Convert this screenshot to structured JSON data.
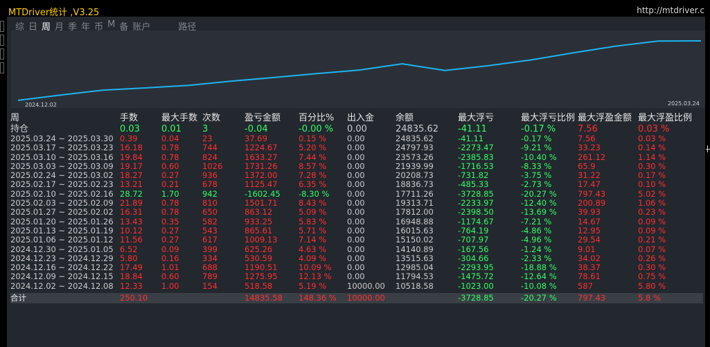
{
  "app": {
    "title": "MTDriver统计 ,V3.25",
    "url": "http://mtdriver.c"
  },
  "tabs": [
    {
      "label": "综"
    },
    {
      "label": "日"
    },
    {
      "label": "周"
    },
    {
      "label": "月"
    },
    {
      "label": "季"
    },
    {
      "label": "年"
    },
    {
      "label": "币"
    },
    {
      "label": "M"
    },
    {
      "label": "备"
    },
    {
      "label": "账户"
    },
    {
      "label": "路径"
    }
  ],
  "active_tab": "周",
  "colors": {
    "positive": "#ff3030",
    "negative": "#33ff66",
    "line": "#1eb4f0",
    "title": "#ffd200"
  },
  "chart_data": {
    "type": "line",
    "x": [
      "2024.12.02",
      "2024.12.09",
      "2024.12.16",
      "2024.12.23",
      "2024.12.30",
      "2025.01.06",
      "2025.01.13",
      "2025.01.20",
      "2025.01.27",
      "2025.02.03",
      "2025.02.10",
      "2025.02.17",
      "2025.02.24",
      "2025.03.03",
      "2025.03.10",
      "2025.03.17",
      "2025.03.24"
    ],
    "series": [
      {
        "values": [
          10518.58,
          11794.53,
          12985.04,
          13515.63,
          14140.89,
          15150.02,
          16015.63,
          16948.88,
          17812.0,
          19313.71,
          17711.26,
          18836.73,
          20208.73,
          21939.99,
          23573.26,
          24797.93,
          24835.62
        ]
      }
    ],
    "x_start_label": "2024.12.02",
    "x_end_label": "2025.03.24",
    "ylim": [
      10000,
      26000
    ],
    "grid": false
  },
  "table": {
    "headers": [
      "周",
      "手数",
      "最大手数",
      "次数",
      "盈亏金额",
      "百分比%",
      "出入金",
      "余额",
      "最大浮亏",
      "最大浮亏比例",
      "最大浮盈金额",
      "最大浮盈比例"
    ],
    "holding": {
      "label": "持仓",
      "cells": [
        "0.03",
        "0.01",
        "3",
        "-0.04",
        "-0.00 %",
        "0.00",
        "24835.62",
        "-41.11",
        "-0.17 %",
        "7.56",
        "0.03 %"
      ],
      "tone": "neg"
    },
    "rows": [
      {
        "cells": [
          "2025.03.24 ~ 2025.03.30",
          "0.39",
          "0.04",
          "23",
          "37.69",
          "0.15 %",
          "0.00",
          "24835.62",
          "-41.11",
          "-0.17 %",
          "7.56",
          "0.03 %"
        ],
        "tone": "pos"
      },
      {
        "cells": [
          "2025.03.17 ~ 2025.03.23",
          "16.18",
          "0.78",
          "744",
          "1224.67",
          "5.20 %",
          "0.00",
          "24797.93",
          "-2273.47",
          "-9.21 %",
          "33.23",
          "0.14 %"
        ],
        "tone": "pos"
      },
      {
        "cells": [
          "2025.03.10 ~ 2025.03.16",
          "19.84",
          "0.78",
          "824",
          "1633.27",
          "7.44 %",
          "0.00",
          "23573.26",
          "-2385.83",
          "-10.40 %",
          "261.12",
          "1.14 %"
        ],
        "tone": "pos"
      },
      {
        "cells": [
          "2025.03.03 ~ 2025.03.09",
          "19.17",
          "0.60",
          "1026",
          "1731.26",
          "8.57 %",
          "0.00",
          "21939.99",
          "-1716.53",
          "-8.33 %",
          "65.9",
          "0.30 %"
        ],
        "tone": "pos"
      },
      {
        "cells": [
          "2025.02.24 ~ 2025.03.02",
          "18.27",
          "0.27",
          "936",
          "1372.00",
          "7.28 %",
          "0.00",
          "20208.73",
          "-731.82",
          "-3.75 %",
          "31.22",
          "0.17 %"
        ],
        "tone": "pos"
      },
      {
        "cells": [
          "2025.02.17 ~ 2025.02.23",
          "13.21",
          "0.21",
          "678",
          "1125.47",
          "6.35 %",
          "0.00",
          "18836.73",
          "-485.33",
          "-2.73 %",
          "17.47",
          "0.10 %"
        ],
        "tone": "pos"
      },
      {
        "cells": [
          "2025.02.10 ~ 2025.02.16",
          "28.72",
          "1.70",
          "942",
          "-1602.45",
          "-8.30 %",
          "0.00",
          "17711.26",
          "-3728.85",
          "-20.27 %",
          "797.43",
          "5.02 %"
        ],
        "tone": "neg"
      },
      {
        "cells": [
          "2025.02.03 ~ 2025.02.09",
          "21.89",
          "0.78",
          "810",
          "1501.71",
          "8.43 %",
          "0.00",
          "19313.71",
          "-2233.97",
          "-12.40 %",
          "200.89",
          "1.06 %"
        ],
        "tone": "pos"
      },
      {
        "cells": [
          "2025.01.27 ~ 2025.02.02",
          "16.31",
          "0.78",
          "650",
          "863.12",
          "5.09 %",
          "0.00",
          "17812.00",
          "-2398.50",
          "-13.69 %",
          "39.93",
          "0.23 %"
        ],
        "tone": "pos"
      },
      {
        "cells": [
          "2025.01.20 ~ 2025.01.26",
          "13.43",
          "0.35",
          "582",
          "933.25",
          "5.83 %",
          "0.00",
          "16948.88",
          "-1174.67",
          "-7.21 %",
          "14.67",
          "0.09 %"
        ],
        "tone": "pos"
      },
      {
        "cells": [
          "2025.01.13 ~ 2025.01.19",
          "10.12",
          "0.27",
          "543",
          "865.61",
          "5.71 %",
          "0.00",
          "16015.63",
          "-764.19",
          "-4.86 %",
          "12.95",
          "0.09 %"
        ],
        "tone": "pos"
      },
      {
        "cells": [
          "2025.01.06 ~ 2025.01.12",
          "11.56",
          "0.27",
          "617",
          "1009.13",
          "7.14 %",
          "0.00",
          "15150.02",
          "-707.97",
          "-4.96 %",
          "29.54",
          "0.21 %"
        ],
        "tone": "pos"
      },
      {
        "cells": [
          "2024.12.30 ~ 2025.01.05",
          "6.52",
          "0.09",
          "399",
          "625.26",
          "4.63 %",
          "0.00",
          "14140.89",
          "-167.56",
          "-1.24 %",
          "9.01",
          "0.07 %"
        ],
        "tone": "pos"
      },
      {
        "cells": [
          "2024.12.23 ~ 2024.12.29",
          "5.80",
          "0.16",
          "334",
          "530.59",
          "4.09 %",
          "0.00",
          "13515.63",
          "-304.66",
          "-2.33 %",
          "34.02",
          "0.26 %"
        ],
        "tone": "pos"
      },
      {
        "cells": [
          "2024.12.16 ~ 2024.12.22",
          "17.49",
          "1.01",
          "688",
          "1190.51",
          "10.09 %",
          "0.00",
          "12985.04",
          "-2293.95",
          "-18.88 %",
          "38.37",
          "0.30 %"
        ],
        "tone": "pos"
      },
      {
        "cells": [
          "2024.12.09 ~ 2024.12.15",
          "18.84",
          "0.60",
          "789",
          "1275.95",
          "12.13 %",
          "0.00",
          "11794.53",
          "-1475.72",
          "-12.64 %",
          "78.61",
          "0.75 %"
        ],
        "tone": "pos"
      },
      {
        "cells": [
          "2024.12.02 ~ 2024.12.08",
          "12.33",
          "1.00",
          "154",
          "518.58",
          "5.19 %",
          "10000.00",
          "10518.58",
          "-1023.00",
          "-10.08 %",
          "587",
          "5.80 %"
        ],
        "tone": "pos"
      }
    ],
    "total": {
      "label": "合计",
      "cells": [
        "250.10",
        "",
        "",
        "14835.58",
        "148.36 %",
        "10000.00",
        "",
        "-3728.85",
        "-20.27 %",
        "797.43",
        "5.8 %"
      ]
    }
  }
}
